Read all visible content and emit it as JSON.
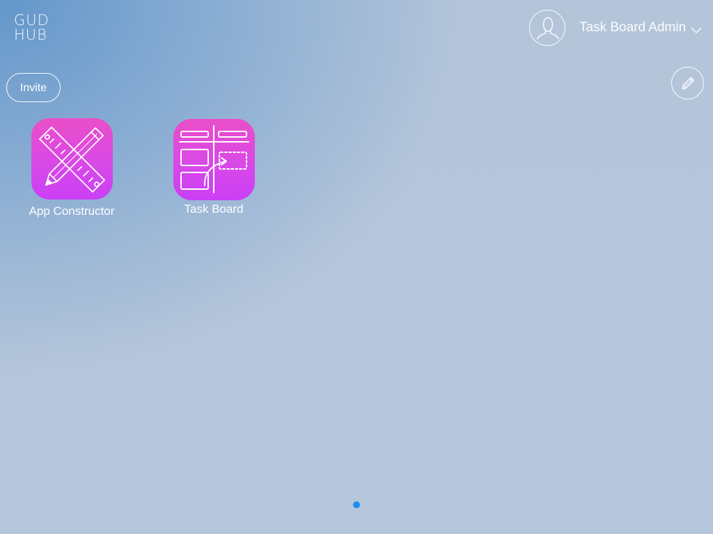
{
  "brand": {
    "logo_line1": "GUD",
    "logo_line2": "HUB"
  },
  "header": {
    "user_name": "Task Board Admin",
    "avatar_icon": "user-silhouette-icon",
    "dropdown_icon": "chevron-down-icon",
    "edit_icon": "pencil-icon"
  },
  "actions": {
    "invite_label": "Invite"
  },
  "apps": [
    {
      "label": "App Constructor",
      "icon": "pencil-ruler-icon"
    },
    {
      "label": "Task Board",
      "icon": "kanban-board-icon"
    }
  ],
  "pagination": {
    "current_page": 1,
    "total_pages": 1,
    "active_color": "#1e8ef0"
  },
  "colors": {
    "app_icon_gradient_top": "#ea4fc9",
    "app_icon_gradient_bottom": "#cb3ff6",
    "background_top_left": "#5f94ca",
    "background_main": "#b6c6da"
  }
}
